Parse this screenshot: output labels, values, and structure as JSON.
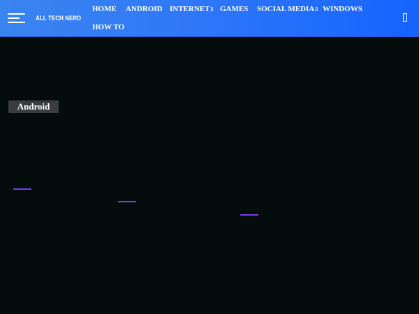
{
  "header": {
    "logo": "ALL TECH NERD",
    "nav": {
      "home": "HOME",
      "android": "ANDROID",
      "internet": "INTERNET",
      "games": "GAMES",
      "social_media": "SOCIAL MEDIA",
      "windows": "WINDOWS",
      "how_to": "HOW TO"
    },
    "dropdown_caret": "▯",
    "icons": {
      "menu": "hamburger-menu-icon",
      "search": "search-icon"
    }
  },
  "main": {
    "category_badge": "Android"
  },
  "colors": {
    "header_gradient_start": "#3a84f0",
    "header_gradient_end": "#1563ff",
    "page_background": "#040c0c",
    "badge_background": "#3a3d3f",
    "link_accent": "#7a3cf0"
  }
}
